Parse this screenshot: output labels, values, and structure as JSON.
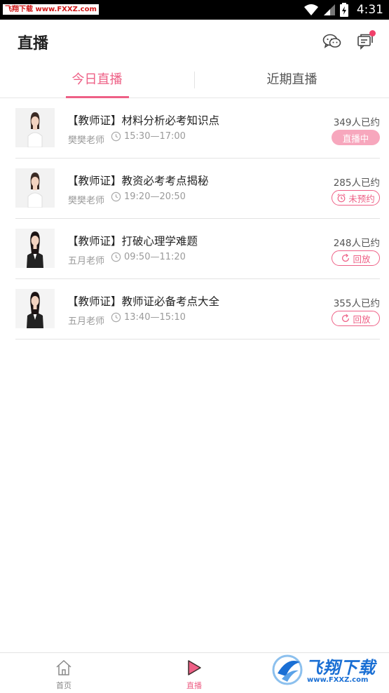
{
  "status_bar": {
    "watermark": "飞翔下载 www.FXXZ.com",
    "time": "4:31"
  },
  "header": {
    "title": "直播",
    "wechat_icon": "wechat-icon",
    "message_icon": "message-icon"
  },
  "tabs": [
    {
      "label": "今日直播",
      "active": true
    },
    {
      "label": "近期直播",
      "active": false
    }
  ],
  "lessons": [
    {
      "title": "【教师证】材料分析必考知识点",
      "teacher": "樊樊老师",
      "time": "15:30—17:00",
      "count": "349人已约",
      "status": "直播中",
      "status_type": "live"
    },
    {
      "title": "【教师证】教资必考考点揭秘",
      "teacher": "樊樊老师",
      "time": "19:20—20:50",
      "count": "285人已约",
      "status": "未预约",
      "status_type": "reserve"
    },
    {
      "title": "【教师证】打破心理学难题",
      "teacher": "五月老师",
      "time": "09:50—11:20",
      "count": "248人已约",
      "status": "回放",
      "status_type": "replay"
    },
    {
      "title": "【教师证】教师证必备考点大全",
      "teacher": "五月老师",
      "time": "13:40—15:10",
      "count": "355人已约",
      "status": "回放",
      "status_type": "replay"
    }
  ],
  "bottom_nav": [
    {
      "label": "首页",
      "icon": "home-icon"
    },
    {
      "label": "直播",
      "icon": "play-icon"
    }
  ],
  "footer_watermark": {
    "text": "飞翔下载",
    "url": "www.FXXZ.com"
  },
  "colors": {
    "accent": "#ee6086",
    "live_badge": "#f7a7bd"
  }
}
